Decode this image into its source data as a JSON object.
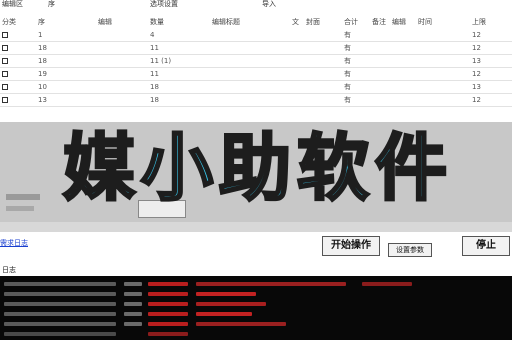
{
  "app": {
    "banner_text": "媒小助软件",
    "link_text": "需求日志",
    "buttons": {
      "start": "开始操作",
      "small": "设置参数",
      "stop": "停止"
    },
    "status_text": "日志"
  },
  "table": {
    "top_labels": [
      "编辑区",
      "序",
      "选项设置",
      "导入"
    ],
    "headers": [
      "分类",
      "序",
      "编辑",
      "数量",
      "编辑标题",
      "文",
      "封面",
      "合计",
      "备注",
      "编辑",
      "时间",
      "上限"
    ],
    "rows": [
      [
        "1",
        "4",
        "有",
        "12"
      ],
      [
        "18",
        "11",
        "有",
        "12"
      ],
      [
        "18",
        "11 (1)",
        "有",
        "13"
      ],
      [
        "19",
        "11",
        "有",
        "12"
      ],
      [
        "10",
        "18",
        "有",
        "13"
      ],
      [
        "13",
        "18",
        "有",
        "12"
      ]
    ]
  },
  "colors": {
    "banner_fill": "#37c9ef",
    "banner_stroke": "#1d1d1d",
    "band": "#c8c8c8",
    "log_background": "#080808",
    "log_red": "#b81e1e",
    "log_gray": "#6a6a6a"
  }
}
